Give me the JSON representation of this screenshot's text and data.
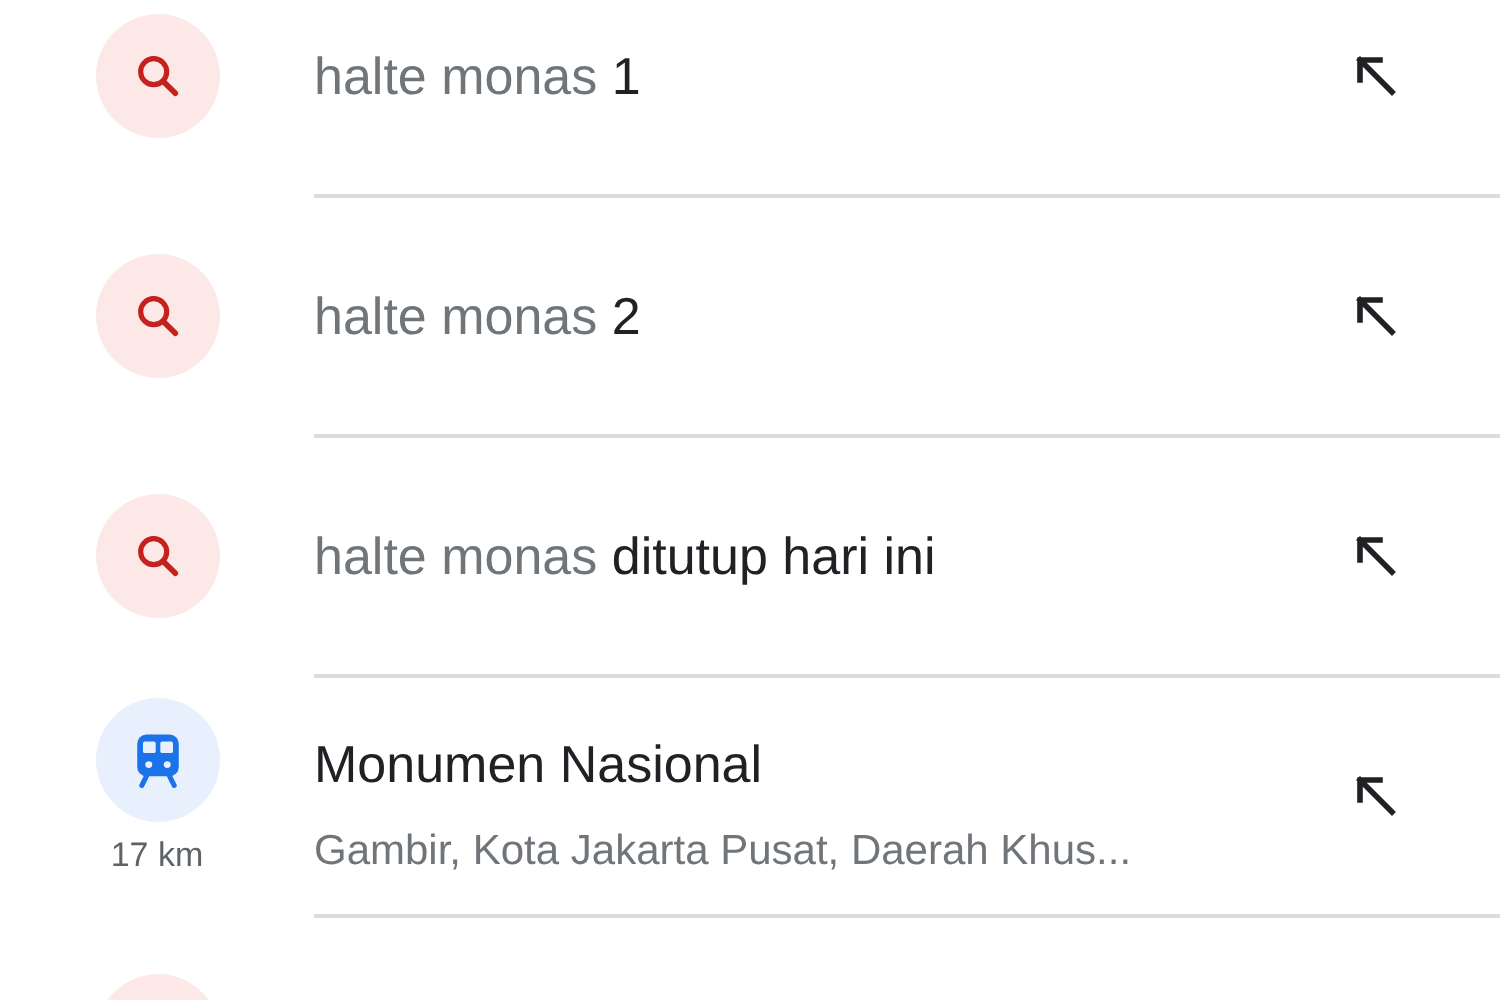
{
  "suggestions": [
    {
      "kind": "search",
      "query": "halte monas",
      "completion": "1"
    },
    {
      "kind": "search",
      "query": "halte monas",
      "completion": "2"
    },
    {
      "kind": "search",
      "query": "halte monas",
      "completion": "ditutup hari ini"
    },
    {
      "kind": "place",
      "title": "Monumen Nasional",
      "subtitle": "Gambir, Kota Jakarta Pusat, Daerah Khus...",
      "distance": "17 km"
    },
    {
      "kind": "search"
    }
  ]
}
